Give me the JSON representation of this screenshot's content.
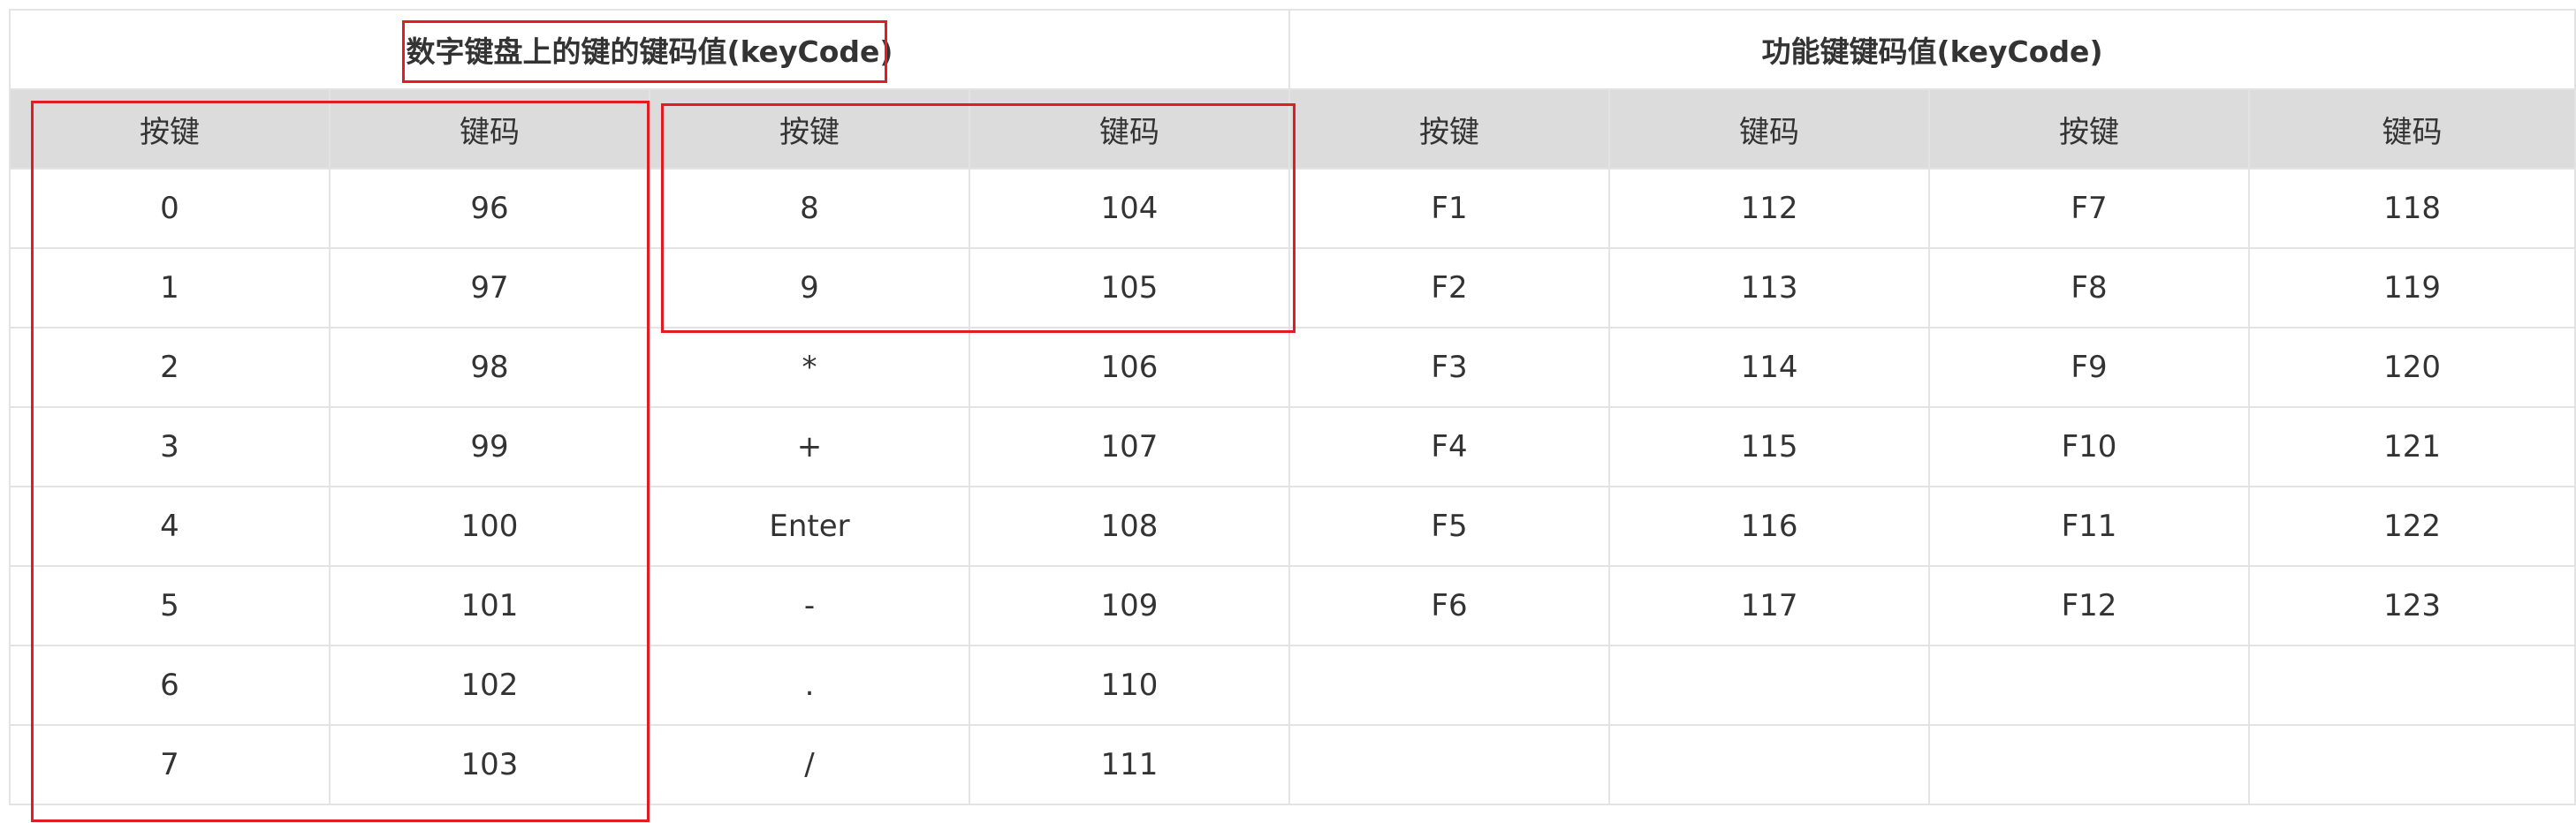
{
  "table": {
    "section_titles": {
      "numpad": "数字键盘上的键的键码值(keyCode)",
      "function": "功能键键码值(keyCode)"
    },
    "headers": [
      "按键",
      "键码",
      "按键",
      "键码",
      "按键",
      "键码",
      "按键",
      "键码"
    ],
    "rows": [
      [
        "0",
        "96",
        "8",
        "104",
        "F1",
        "112",
        "F7",
        "118"
      ],
      [
        "1",
        "97",
        "9",
        "105",
        "F2",
        "113",
        "F8",
        "119"
      ],
      [
        "2",
        "98",
        "*",
        "106",
        "F3",
        "114",
        "F9",
        "120"
      ],
      [
        "3",
        "99",
        "+",
        "107",
        "F4",
        "115",
        "F10",
        "121"
      ],
      [
        "4",
        "100",
        "Enter",
        "108",
        "F5",
        "116",
        "F11",
        "122"
      ],
      [
        "5",
        "101",
        "-",
        "109",
        "F6",
        "117",
        "F12",
        "123"
      ],
      [
        "6",
        "102",
        ".",
        "110",
        "",
        "",
        "",
        ""
      ],
      [
        "7",
        "103",
        "/",
        "111",
        "",
        "",
        "",
        ""
      ]
    ]
  },
  "colors": {
    "highlight_border": "#e31b23",
    "header_bg": "#dcdcdc",
    "grid_line": "#e3e3e3",
    "text": "#333333"
  }
}
